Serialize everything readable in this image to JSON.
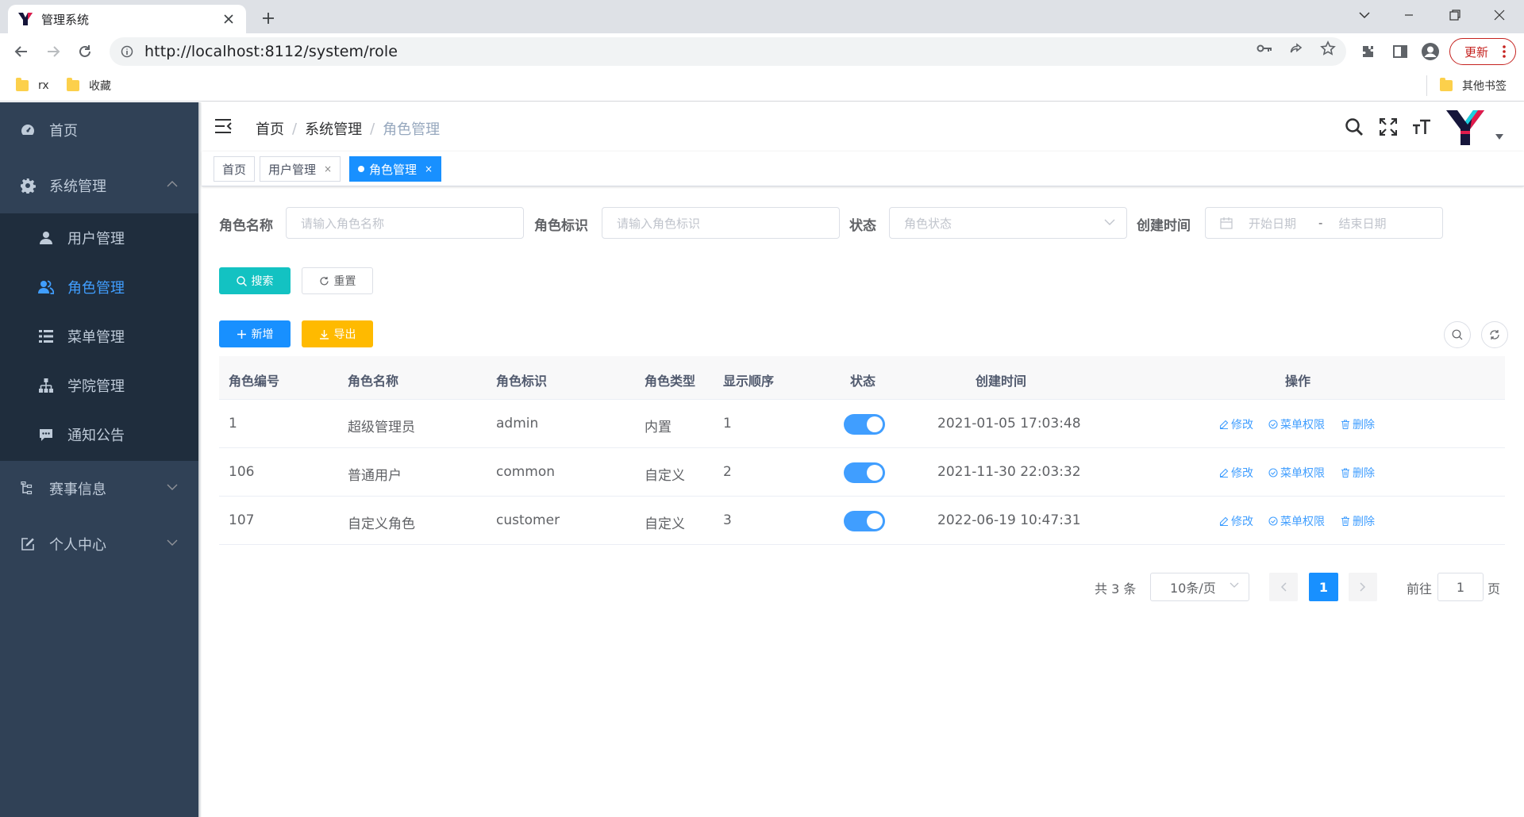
{
  "browser": {
    "tab_title": "管理系统",
    "url": "http://localhost:8112/system/role",
    "update_label": "更新",
    "bookmarks": [
      "rx",
      "收藏"
    ],
    "other_bookmarks": "其他书签"
  },
  "sidebar": {
    "home": "首页",
    "system": "系统管理",
    "submenu": [
      "用户管理",
      "角色管理",
      "菜单管理",
      "学院管理",
      "通知公告"
    ],
    "match": "赛事信息",
    "profile": "个人中心"
  },
  "breadcrumb": [
    "首页",
    "系统管理",
    "角色管理"
  ],
  "tags": [
    "首页",
    "用户管理",
    "角色管理"
  ],
  "search": {
    "role_name_label": "角色名称",
    "role_name_placeholder": "请输入角色名称",
    "role_key_label": "角色标识",
    "role_key_placeholder": "请输入角色标识",
    "status_label": "状态",
    "status_placeholder": "角色状态",
    "created_label": "创建时间",
    "start_placeholder": "开始日期",
    "range_sep": "-",
    "end_placeholder": "结束日期",
    "search_btn": "搜索",
    "reset_btn": "重置"
  },
  "actions": {
    "add": "新增",
    "export": "导出"
  },
  "table": {
    "headers": [
      "角色编号",
      "角色名称",
      "角色标识",
      "角色类型",
      "显示顺序",
      "状态",
      "创建时间",
      "操作"
    ],
    "rows": [
      {
        "id": "1",
        "name": "超级管理员",
        "key": "admin",
        "type": "内置",
        "order": "1",
        "enabled": true,
        "created": "2021-01-05 17:03:48"
      },
      {
        "id": "106",
        "name": "普通用户",
        "key": "common",
        "type": "自定义",
        "order": "2",
        "enabled": true,
        "created": "2021-11-30 22:03:32"
      },
      {
        "id": "107",
        "name": "自定义角色",
        "key": "customer",
        "type": "自定义",
        "order": "3",
        "enabled": true,
        "created": "2022-06-19 10:47:31"
      }
    ],
    "ops": {
      "edit": "修改",
      "perm": "菜单权限",
      "del": "删除"
    }
  },
  "pagination": {
    "total": "共 3 条",
    "page_size": "10条/页",
    "current": "1",
    "goto": "前往",
    "goto_value": "1",
    "unit": "页"
  },
  "colors": {
    "sidebar": "#304156",
    "submenu": "#1f2d3d",
    "primary": "#1890ff",
    "accent": "#409eff",
    "search": "#13c2c2",
    "export": "#ffba00"
  }
}
